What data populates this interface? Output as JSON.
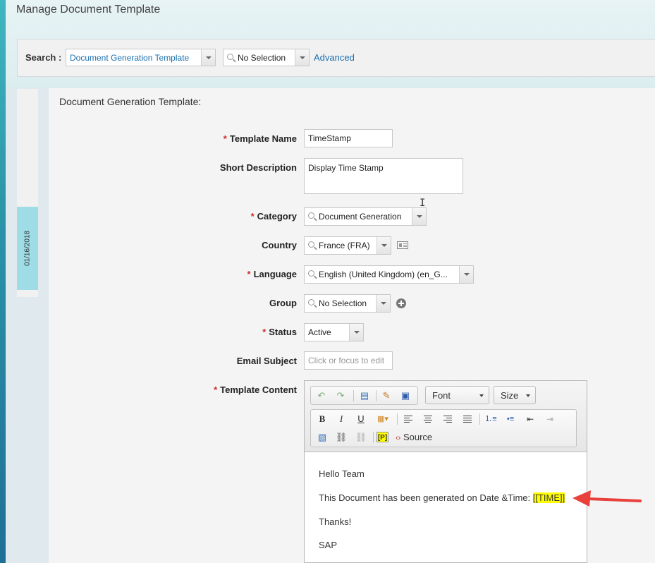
{
  "page_title": "Manage Document Template",
  "search": {
    "label": "Search :",
    "type_value": "Document Generation Template",
    "item_value": "No Selection",
    "advanced_link": "Advanced"
  },
  "timeline": {
    "date": "01/16/2018"
  },
  "form": {
    "section_title": "Document Generation Template:",
    "template_name": {
      "label": "Template Name",
      "required": "*",
      "value": "TimeStamp"
    },
    "short_description": {
      "label": "Short Description",
      "value": "Display Time Stamp"
    },
    "category": {
      "label": "Category",
      "required": "*",
      "value": "Document Generation"
    },
    "country": {
      "label": "Country",
      "value": "France (FRA)"
    },
    "language": {
      "label": "Language",
      "required": "*",
      "value": "English (United Kingdom) (en_G..."
    },
    "group": {
      "label": "Group",
      "value": "No Selection"
    },
    "status": {
      "label": "Status",
      "required": "*",
      "value": "Active"
    },
    "email_subject": {
      "label": "Email Subject",
      "placeholder": "Click or focus to edit"
    },
    "template_content": {
      "label": "Template Content",
      "required": "*"
    }
  },
  "editor": {
    "toolbar": {
      "font_label": "Font",
      "size_label": "Size",
      "bold": "B",
      "italic": "I",
      "underline": "U",
      "placeholder_btn": "[P]",
      "source_label": "Source"
    },
    "content": {
      "line1": "Hello Team",
      "line2_prefix": "This Document has been generated on Date &Time:",
      "line2_token": "[[TIME]]",
      "line3": "Thanks!",
      "line4": "SAP"
    }
  },
  "colors": {
    "required": "#d42b2b",
    "link": "#1a6fae",
    "highlight": "#ffff00",
    "annotation_arrow": "#e8403a",
    "timeline_marker": "#9edde6"
  }
}
